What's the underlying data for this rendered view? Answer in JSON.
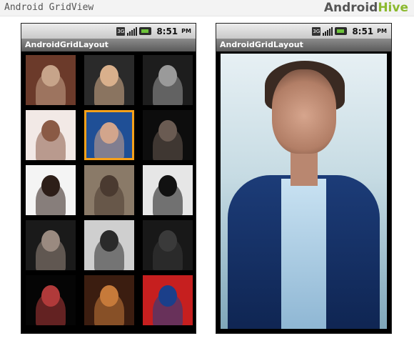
{
  "header": {
    "title": "Android GridView",
    "brand_part1": "Android",
    "brand_part2": "Hive",
    "brand_color": "#8bb92f"
  },
  "status_bar": {
    "network_label": "3G",
    "time": "8:51",
    "ampm": "PM",
    "icons": [
      "network-3g-icon",
      "signal-icon",
      "battery-icon"
    ]
  },
  "left_screen": {
    "app_title": "AndroidGridLayout",
    "selected_index": 4,
    "selection_color": "#f7a11a",
    "tiles": [
      {
        "bg": "#6b3a2a",
        "fg": "#c7a48a"
      },
      {
        "bg": "#2a2a2a",
        "fg": "#d9b08c"
      },
      {
        "bg": "#1d1d1d",
        "fg": "#9a9a9a"
      },
      {
        "bg": "#f2e9e6",
        "fg": "#8a5a45"
      },
      {
        "bg": "#1f4f96",
        "fg": "#d2a58c"
      },
      {
        "bg": "#0d0d0d",
        "fg": "#6a5b52"
      },
      {
        "bg": "#f4f4f4",
        "fg": "#2d1e18"
      },
      {
        "bg": "#8a7a68",
        "fg": "#4a3a30"
      },
      {
        "bg": "#e6e6e6",
        "fg": "#111111"
      },
      {
        "bg": "#1a1a1a",
        "fg": "#9a8a80"
      },
      {
        "bg": "#cfcfcf",
        "fg": "#2a2a2a"
      },
      {
        "bg": "#181818",
        "fg": "#3a3a3a"
      },
      {
        "bg": "#050505",
        "fg": "#b03a3a"
      },
      {
        "bg": "#3b1d10",
        "fg": "#c67a3a"
      },
      {
        "bg": "#c61f1f",
        "fg": "#1b3f8a"
      }
    ]
  },
  "right_screen": {
    "app_title": "AndroidGridLayout"
  }
}
